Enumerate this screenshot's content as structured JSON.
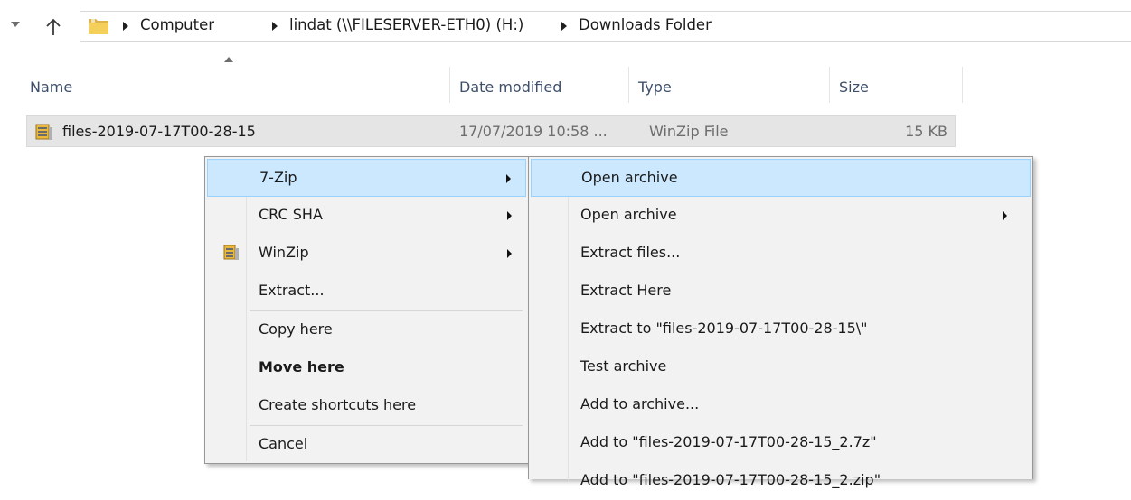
{
  "address_bar": {
    "breadcrumbs": [
      "Computer",
      "lindat (\\\\FILESERVER-ETH0) (H:)",
      "Downloads Folder"
    ]
  },
  "columns": {
    "name": "Name",
    "date": "Date modified",
    "type": "Type",
    "size": "Size"
  },
  "file": {
    "name": "files-2019-07-17T00-28-15",
    "date": "17/07/2019 10:58 ...",
    "type": "WinZip File",
    "size": "15 KB"
  },
  "context_menu": {
    "items": [
      {
        "label": "7-Zip",
        "submenu": true,
        "highlighted": true
      },
      {
        "label": "CRC SHA",
        "submenu": true
      },
      {
        "label": "WinZip",
        "submenu": true,
        "icon": "winzip-icon"
      },
      {
        "label": "Extract..."
      },
      {
        "label": "Copy here"
      },
      {
        "label": "Move here",
        "bold": true
      },
      {
        "label": "Create shortcuts here"
      },
      {
        "label": "Cancel"
      }
    ]
  },
  "zip_submenu": {
    "items": [
      {
        "label": "Open archive",
        "highlighted": true
      },
      {
        "label": "Open archive",
        "submenu": true
      },
      {
        "label": "Extract files..."
      },
      {
        "label": "Extract Here"
      },
      {
        "label": "Extract to \"files-2019-07-17T00-28-15\\\""
      },
      {
        "label": "Test archive"
      },
      {
        "label": "Add to archive..."
      },
      {
        "label": "Add to \"files-2019-07-17T00-28-15_2.7z\""
      },
      {
        "label": "Add to \"files-2019-07-17T00-28-15_2.zip\""
      }
    ]
  },
  "colors": {
    "menu_background": "#f2f2f2",
    "menu_highlight": "#cce8ff",
    "menu_highlight_border": "#99d1ff",
    "selected_row": "#e5e5e5",
    "column_header_text": "#3f4f6a"
  }
}
